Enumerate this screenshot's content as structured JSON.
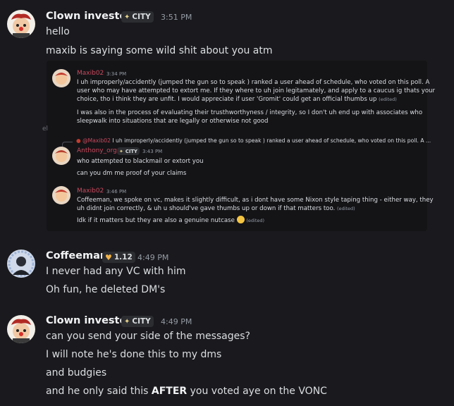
{
  "messages": [
    {
      "author": "Clown investor",
      "tag": "CITY",
      "time": "3:51 PM",
      "lines": [
        "hello",
        "maxib is saying some wild shit about you atm"
      ]
    },
    {
      "author": "Coffeeman",
      "tag": "1.12",
      "time": "4:49 PM",
      "lines": [
        "I never had any VC with him",
        "Oh fun, he deleted DM's"
      ]
    },
    {
      "author": "Clown investor",
      "tag": "CITY",
      "time": "4:49 PM",
      "lines": [
        "can you send your side of the messages?",
        "I will note he's done this to my dms",
        "and budgies"
      ],
      "last_line": {
        "before": "and he only said this ",
        "bold": "AFTER",
        "after": " you voted aye on the VONC"
      }
    }
  ],
  "screenshot": {
    "m1": {
      "author": "Maxib02",
      "time": "3:34 PM",
      "lines": [
        "I uh improperly/accidently (jumped the gun so to speak ) ranked a user ahead of schedule, who voted on this poll. A",
        "user who may have attempted to extort me. If they where to uh join legitamately, and apply to a caucus ig thats your",
        "choice, tho i think they are unfit. I would appreciate if user 'Gromit' could get an official thumbs up"
      ],
      "lines2": [
        "I was also in the process of evaluating their trusthworthyness / integrity, so I don't uh end up with associates who",
        "sleepwalk into situations that are legally or otherwise not good"
      ],
      "edited": "(edited)"
    },
    "side_fragment": "el",
    "reply": {
      "author": "@Maxib02",
      "preview": "I uh improperly/accidently (jumped the gun so to speak ) ranked a user ahead of schedule, who voted on this poll. A ..."
    },
    "m2": {
      "author": "Anthony_org",
      "tag": "CITY",
      "time": "3:43 PM",
      "lines": [
        "who attempted to blackmail or extort you",
        "can you dm me proof of your claims"
      ]
    },
    "m3": {
      "author": "Maxib02",
      "time": "3:46 PM",
      "lines": [
        "Coffeeman, we spoke on vc, makes it slightly difficult, as i dont have some Nixon style taping thing - either way, they",
        "uh didnt join correctly, & uh u should've gave thumbs up or down if that matters too."
      ],
      "last": "Idk if it matters but they are also a genuine nutcase",
      "edited": "(edited)"
    }
  },
  "colors": {
    "background": "#1a1a1e",
    "text": "#dbdee1",
    "timestamp": "#949ba4",
    "embedded_name": "#c94a5d"
  }
}
